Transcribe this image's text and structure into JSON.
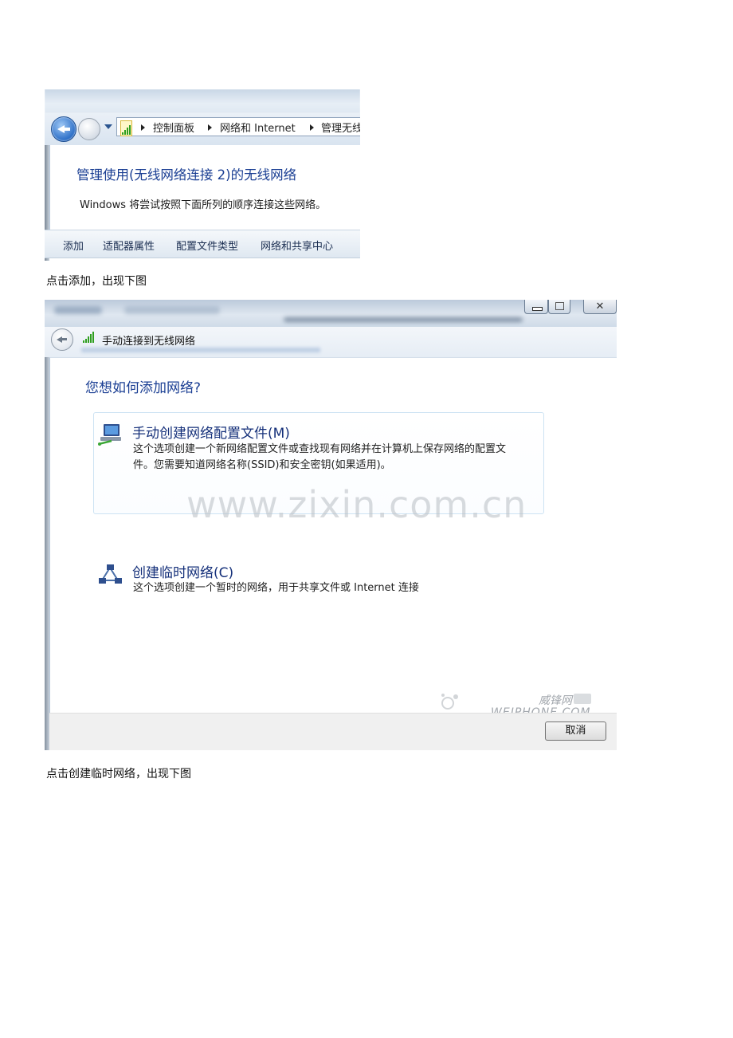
{
  "screenshot1": {
    "breadcrumb": [
      "控制面板",
      "网络和 Internet",
      "管理无线"
    ],
    "heading": "管理使用(无线网络连接 2)的无线网络",
    "description": "Windows 将尝试按照下面所列的顺序连接这些网络。",
    "toolbar": [
      "添加",
      "适配器属性",
      "配置文件类型",
      "网络和共享中心"
    ]
  },
  "caption1": "点击添加，出现下图",
  "screenshot2": {
    "window_title": "手动连接到无线网络",
    "question": "您想如何添加网络?",
    "option1": {
      "title": "手动创建网络配置文件(M)",
      "desc_line1": "这个选项创建一个新网络配置文件或查找现有网络并在计算机上保存网络的配置文",
      "desc_line2": "件。您需要知道网络名称(SSID)和安全密钥(如果适用)。"
    },
    "option2": {
      "title": "创建临时网络(C)",
      "desc": "这个选项创建一个暂时的网络，用于共享文件或 Internet 连接"
    },
    "watermark": "www.zixin.com.cn",
    "logo_text": "威锋网",
    "logo_subtext": "WEIPHONE.COM",
    "cancel_label": "取消",
    "close_glyph": "✕"
  },
  "caption2": "点击创建临时网络，出现下图",
  "colors": {
    "heading_blue": "#1a3e93",
    "signal_green": "#2e9e1e"
  }
}
